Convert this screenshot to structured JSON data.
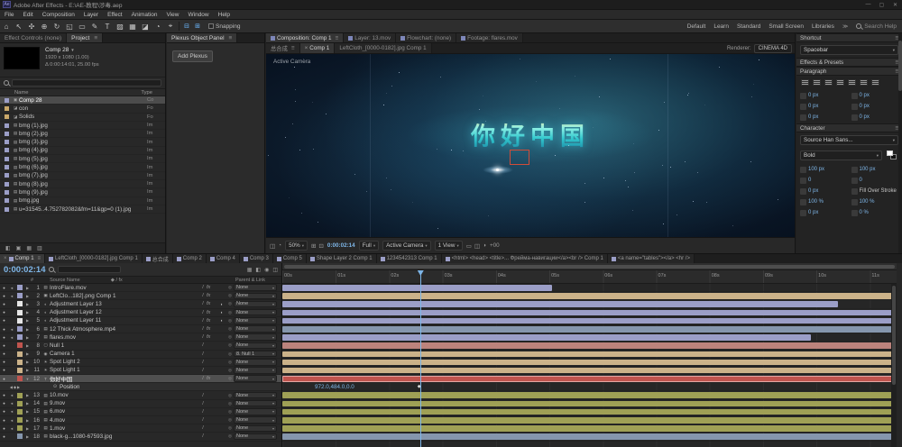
{
  "titlebar": {
    "app": "Ae",
    "title": "Adobe After Effects - E:\\AE-教程\\涉毒.aep",
    "min": "—",
    "max": "▢",
    "close": "✕"
  },
  "menubar": [
    "File",
    "Edit",
    "Composition",
    "Layer",
    "Effect",
    "Animation",
    "View",
    "Window",
    "Help"
  ],
  "toolbar": {
    "tools": [
      {
        "name": "home",
        "g": "⌂"
      },
      {
        "name": "selection",
        "g": "↖"
      },
      {
        "name": "hand",
        "g": "✣"
      },
      {
        "name": "zoom",
        "g": "⊕"
      },
      {
        "name": "orbit-camera",
        "g": "↻"
      },
      {
        "name": "pan-behind",
        "g": "◱"
      },
      {
        "name": "mask-shape",
        "g": "▭"
      },
      {
        "name": "pen",
        "g": "✎"
      },
      {
        "name": "type",
        "g": "T"
      },
      {
        "name": "brush",
        "g": "▨"
      },
      {
        "name": "clone-stamp",
        "g": "▦"
      },
      {
        "name": "eraser",
        "g": "◪"
      },
      {
        "name": "roto-brush",
        "g": "◔"
      },
      {
        "name": "puppet-pin",
        "g": "⌖"
      }
    ],
    "snap_icons": [
      {
        "name": "align-toggle",
        "g": "⊟"
      },
      {
        "name": "grid-toggle",
        "g": "⊞"
      }
    ],
    "snapping_label": "Snapping",
    "workspaces": [
      "Default",
      "Learn",
      "Standard",
      "Small Screen",
      "Libraries"
    ],
    "more": "≫",
    "search_help": "Search Help"
  },
  "project": {
    "tabs": [
      {
        "label": "Effect Controls (none)"
      },
      {
        "label": "Project"
      }
    ],
    "comp": {
      "name": "Comp 28",
      "caret": "▼",
      "line1": "1920 x 1080 (1.00)",
      "line2": "Δ 0:00:14:01, 25.00 fps"
    },
    "columns": {
      "name": "Name",
      "type": "Type"
    },
    "items": [
      {
        "name": "Comp 28",
        "type": "Co",
        "swatch": "#9b9ec7",
        "icon": "▣",
        "selected": true
      },
      {
        "name": "con",
        "type": "Fo",
        "swatch": "#c9a86a",
        "icon": "◪"
      },
      {
        "name": "Solids",
        "type": "Fo",
        "swatch": "#c9a86a",
        "icon": "◪"
      },
      {
        "name": "bmg (1).jpg",
        "type": "Im",
        "swatch": "#9b9ec7",
        "icon": "▤"
      },
      {
        "name": "bmg (2).jpg",
        "type": "Im",
        "swatch": "#9b9ec7",
        "icon": "▤"
      },
      {
        "name": "bmg (3).jpg",
        "type": "Im",
        "swatch": "#9b9ec7",
        "icon": "▤"
      },
      {
        "name": "bmg (4).jpg",
        "type": "Im",
        "swatch": "#9b9ec7",
        "icon": "▤"
      },
      {
        "name": "bmg (5).jpg",
        "type": "Im",
        "swatch": "#9b9ec7",
        "icon": "▤"
      },
      {
        "name": "bmg (6).jpg",
        "type": "Im",
        "swatch": "#9b9ec7",
        "icon": "▤"
      },
      {
        "name": "bmg (7).jpg",
        "type": "Im",
        "swatch": "#9b9ec7",
        "icon": "▤"
      },
      {
        "name": "bmg (8).jpg",
        "type": "Im",
        "swatch": "#9b9ec7",
        "icon": "▤"
      },
      {
        "name": "bmg (9).jpg",
        "type": "Im",
        "swatch": "#9b9ec7",
        "icon": "▤"
      },
      {
        "name": "bmg.jpg",
        "type": "Im",
        "swatch": "#9b9ec7",
        "icon": "▤"
      },
      {
        "name": "u=31545..4.752782082&fm=11&gp=0 (1).jpg",
        "type": "Im",
        "swatch": "#9b9ec7",
        "icon": "▤"
      }
    ],
    "footer_icons": [
      {
        "name": "interpret-footage",
        "g": "◧"
      },
      {
        "name": "new-folder",
        "g": "▣"
      },
      {
        "name": "new-composition",
        "g": "▦"
      },
      {
        "name": "delete",
        "g": "▥"
      }
    ]
  },
  "plexus": {
    "title": "Plexus Object Panel",
    "menu": "≡",
    "button": "Add Plexus"
  },
  "viewer": {
    "panel_tabs": [
      {
        "label": "Composition: Comp 1",
        "active": true,
        "menu": "≡"
      },
      {
        "label": "Layer: 13.mov"
      },
      {
        "label": "Flowchart: (none)"
      },
      {
        "label": "Footage: flares.mov"
      }
    ],
    "comp_tabs": [
      {
        "label": "总合成",
        "menu": "≡"
      },
      {
        "label": "Comp 1",
        "close": "×",
        "active": true
      },
      {
        "label": "LeftCloth_[0000-0182].jpg Comp 1"
      }
    ],
    "renderer_label": "Renderer:",
    "renderer_value": "CINEMA 4D",
    "overlay": "Active Camera",
    "comp_text": "你好中国",
    "statusbar": {
      "icons_a": [
        {
          "name": "snapshot",
          "g": "◫"
        },
        {
          "name": "show-channel",
          "g": "◔"
        }
      ],
      "zoom": "50%",
      "icons_b": [
        {
          "name": "grid-guides",
          "g": "⊞"
        },
        {
          "name": "mask-toggle",
          "g": "⊡"
        }
      ],
      "timecode": "0:00:02:14",
      "resolution": "Full",
      "camera": "Active Camera",
      "views": "1 View",
      "icons_c": [
        {
          "name": "region-of-interest",
          "g": "▭"
        },
        {
          "name": "pixel-aspect",
          "g": "◫"
        },
        {
          "name": "exposure",
          "g": "◑"
        }
      ],
      "exposure": "+00"
    }
  },
  "rightbar": {
    "shortcut": {
      "title": "Shortcut",
      "value": "Spacebar"
    },
    "effects": {
      "title": "Effects & Presets"
    },
    "paragraph": {
      "title": "Paragraph",
      "fields": [
        [
          "0 px",
          "0 px"
        ],
        [
          "0 px",
          "0 px"
        ],
        [
          "0 px",
          "0 px"
        ]
      ]
    },
    "character": {
      "title": "Character",
      "font": "Source Han Sans...",
      "style": "Bold",
      "rows": [
        [
          "100 px",
          "100 px"
        ],
        [
          "0",
          "0"
        ],
        [
          "0 px",
          "Fill Over Stroke"
        ],
        [
          "100 %",
          "100 %"
        ],
        [
          "0 px",
          "0 %"
        ]
      ]
    }
  },
  "bottom_tabs": [
    {
      "label": "Comp 1",
      "close": "×",
      "active": true,
      "menu": "≡",
      "swatch": "#9b9ec7"
    },
    {
      "label": "LeftCloth_[0000-0182].jpg Comp 1",
      "swatch": "#9b9ec7"
    },
    {
      "label": "总合成",
      "swatch": "#9b9ec7"
    },
    {
      "label": "Comp 2",
      "swatch": "#9b9ec7"
    },
    {
      "label": "Comp 4",
      "swatch": "#9b9ec7"
    },
    {
      "label": "Comp 3",
      "swatch": "#9b9ec7"
    },
    {
      "label": "Comp 5",
      "swatch": "#9b9ec7"
    },
    {
      "label": "Shape Layer 2 Comp 1",
      "swatch": "#9b9ec7"
    },
    {
      "label": "1234542313 Comp 1",
      "swatch": "#9b9ec7"
    },
    {
      "label": "<html> <head> <title>... Фрейма-навигации</a><br /> Comp 1",
      "swatch": "#9b9ec7"
    },
    {
      "label": "<a name=\"tables\"></a> <hr />",
      "swatch": "#9b9ec7"
    }
  ],
  "timeline": {
    "timecode": "0:00:02:14",
    "headers": {
      "num": "#",
      "source": "Source Name",
      "switches": "◆ / fx",
      "parent": "Parent & Link"
    },
    "head_icons": [
      {
        "name": "composition-mini-flowchart",
        "g": "▦"
      },
      {
        "name": "draft-3d",
        "g": "◧"
      },
      {
        "name": "motion-blur",
        "g": "◉"
      },
      {
        "name": "graph-editor",
        "g": "◫"
      }
    ],
    "ruler": [
      "00s",
      "01s",
      "02s",
      "03s",
      "04s",
      "05s",
      "06s",
      "07s",
      "08s",
      "09s",
      "10s",
      "11s"
    ],
    "total_seconds": 11.5,
    "playhead_seconds": 2.58,
    "layers": [
      {
        "num": 1,
        "name": "IntroFlare.mov",
        "swatch": "#9b9ec7",
        "icon": "▤",
        "av": true,
        "fx": true,
        "parent": "None",
        "bar": {
          "color": "#9b9ec7",
          "start": 0,
          "end": 5.05
        }
      },
      {
        "num": 2,
        "name": "LeftClo...182].png Comp 1",
        "swatch": "#9b9ec7",
        "icon": "▣",
        "av": true,
        "fx": true,
        "parent": "None",
        "bar": {
          "color": "#cbb289",
          "start": 0,
          "end": 11.5
        }
      },
      {
        "num": 3,
        "name": "Adjustment Layer 13",
        "swatch": "#e6e6e6",
        "icon": "◐",
        "adj": true,
        "fx": true,
        "parent": "None",
        "bar": {
          "color": "#9b9ec7",
          "start": 0,
          "end": 10.4
        }
      },
      {
        "num": 4,
        "name": "Adjustment Layer 12",
        "swatch": "#e6e6e6",
        "icon": "◐",
        "adj": true,
        "fx": true,
        "parent": "None",
        "bar": {
          "color": "#9b9ec7",
          "start": 0,
          "end": 11.5
        }
      },
      {
        "num": 5,
        "name": "Adjustment Layer 11",
        "swatch": "#e6e6e6",
        "icon": "◐",
        "adj": true,
        "fx": true,
        "parent": "None",
        "bar": {
          "color": "#9b9ec7",
          "start": 0,
          "end": 11.5
        }
      },
      {
        "num": 6,
        "name": "12 Thick Atmosphere.mp4",
        "swatch": "#9b9ec7",
        "icon": "▤",
        "av": true,
        "fx": true,
        "parent": "None",
        "bar": {
          "color": "#8596ad",
          "start": 0,
          "end": 11.5
        }
      },
      {
        "num": 7,
        "name": "flares.mov",
        "swatch": "#9b9ec7",
        "icon": "▤",
        "av": true,
        "fx": true,
        "parent": "None",
        "bar": {
          "color": "#9b9ec7",
          "start": 0,
          "end": 9.9
        }
      },
      {
        "num": 8,
        "name": "Null 1",
        "swatch": "#c0544e",
        "icon": "▢",
        "parent": "None",
        "bar": {
          "color": "#bc837c",
          "start": 0,
          "end": 11.5
        }
      },
      {
        "num": 9,
        "name": "Camera 1",
        "swatch": "#cbb289",
        "icon": "◉",
        "parent": "8. Null 1",
        "bar": {
          "color": "#cbb289",
          "start": 0,
          "end": 11.5
        }
      },
      {
        "num": 10,
        "name": "Spot Light 2",
        "swatch": "#cbb289",
        "icon": "☀",
        "parent": "None",
        "bar": {
          "color": "#cbb289",
          "start": 0,
          "end": 11.5
        }
      },
      {
        "num": 11,
        "name": "Spot Light 1",
        "swatch": "#cbb289",
        "icon": "☀",
        "parent": "None",
        "bar": {
          "color": "#cbb289",
          "start": 0,
          "end": 11.5
        }
      },
      {
        "num": 12,
        "name": "你好中国",
        "swatch": "#c0544e",
        "icon": "T",
        "selected": true,
        "expanded": true,
        "fx": true,
        "parent": "None",
        "bar": {
          "color": "#c0544e",
          "start": 0,
          "end": 11.5
        }
      },
      {
        "property": true,
        "stopwatch": "⊙",
        "name": "Position",
        "value": "972.0,484.0,0.0",
        "keyframe_at": 2.58
      },
      {
        "num": 13,
        "name": "10.mov",
        "swatch": "#9fa055",
        "icon": "▤",
        "av": true,
        "parent": "None",
        "bar": {
          "color": "#9fa055",
          "start": 0,
          "end": 11.5
        }
      },
      {
        "num": 14,
        "name": "9.mov",
        "swatch": "#9fa055",
        "icon": "▤",
        "av": true,
        "parent": "None",
        "bar": {
          "color": "#9fa055",
          "start": 0,
          "end": 11.5
        }
      },
      {
        "num": 15,
        "name": "6.mov",
        "swatch": "#9fa055",
        "icon": "▤",
        "av": true,
        "parent": "None",
        "bar": {
          "color": "#9fa055",
          "start": 0,
          "end": 11.5
        }
      },
      {
        "num": 16,
        "name": "4.mov",
        "swatch": "#9fa055",
        "icon": "▤",
        "av": true,
        "parent": "None",
        "bar": {
          "color": "#9fa055",
          "start": 0,
          "end": 11.5
        }
      },
      {
        "num": 17,
        "name": "1.mov",
        "swatch": "#9fa055",
        "icon": "▤",
        "av": true,
        "parent": "None",
        "bar": {
          "color": "#9fa055",
          "start": 0,
          "end": 11.5
        }
      },
      {
        "num": 18,
        "name": "black-g...1080-67593.jpg",
        "swatch": "#8596ad",
        "icon": "▤",
        "parent": "None",
        "bar": {
          "color": "#8596ad",
          "start": 0,
          "end": 11.5
        }
      }
    ]
  }
}
